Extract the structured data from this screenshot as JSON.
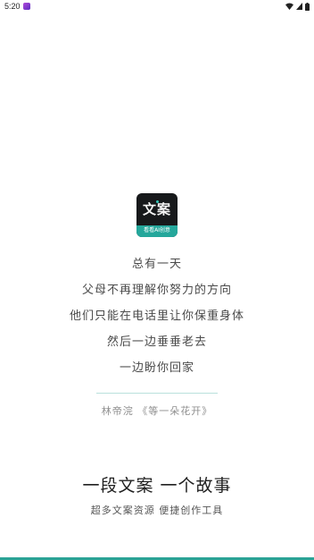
{
  "status_bar": {
    "time": "5:20"
  },
  "logo": {
    "title": "文案",
    "subtitle": "看看AI创意"
  },
  "poem": {
    "lines": [
      "总有一天",
      "父母不再理解你努力的方向",
      "他们只能在电话里让你保重身体",
      "然后一边垂垂老去",
      "一边盼你回家"
    ],
    "attribution": "林帝浣 《等一朵花开》"
  },
  "slogan": {
    "main": "一段文案 一个故事",
    "sub": "超多文案资源 便捷创作工具"
  },
  "colors": {
    "accent": "#2aa396",
    "logo_background": "#17191b",
    "divider": "#b9e1dc"
  }
}
